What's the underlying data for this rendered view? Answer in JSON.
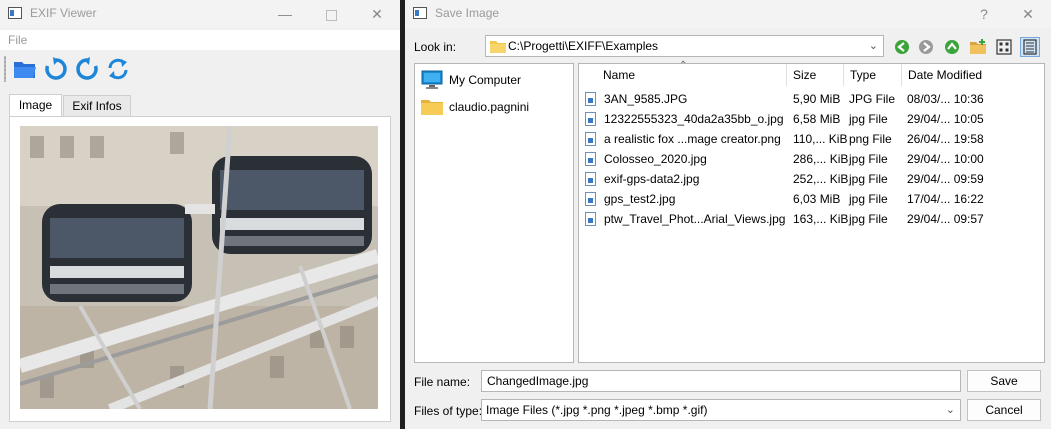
{
  "exif_viewer": {
    "title": "EXIF Viewer",
    "menu": {
      "file": "File"
    },
    "toolbar": {
      "open": "folder-open-icon",
      "rotate_cw": "rotate-clockwise-icon",
      "rotate_ccw": "rotate-counterclockwise-icon",
      "refresh": "refresh-icon"
    },
    "tabs": [
      {
        "label": "Image"
      },
      {
        "label": "Exif Infos"
      }
    ],
    "active_tab": "Image"
  },
  "save_dialog": {
    "title": "Save Image",
    "help_button": "?",
    "close_button": "✕",
    "look_in_label": "Look in:",
    "look_in_path": "C:\\Progetti\\EXIFF\\Examples",
    "sidebar": [
      {
        "label": "My Computer",
        "icon": "computer-icon"
      },
      {
        "label": "claudio.pagnini",
        "icon": "folder-icon"
      }
    ],
    "columns": {
      "name": "Name",
      "size": "Size",
      "type": "Type",
      "date": "Date Modified"
    },
    "files": [
      {
        "name": "3AN_9585.JPG",
        "size": "5,90 MiB",
        "type": "JPG File",
        "date": "08/03/... 10:36"
      },
      {
        "name": "12322555323_40da2a35bb_o.jpg",
        "size": "6,58 MiB",
        "type": "jpg File",
        "date": "29/04/... 10:05"
      },
      {
        "name": "a realistic fox ...mage creator.png",
        "size": "110,... KiB",
        "type": "png File",
        "date": "26/04/... 19:58"
      },
      {
        "name": "Colosseo_2020.jpg",
        "size": "286,... KiB",
        "type": "jpg File",
        "date": "29/04/... 10:00"
      },
      {
        "name": "exif-gps-data2.jpg",
        "size": "252,... KiB",
        "type": "jpg File",
        "date": "29/04/... 09:59"
      },
      {
        "name": "gps_test2.jpg",
        "size": "6,03 MiB",
        "type": "jpg File",
        "date": "17/04/... 16:22"
      },
      {
        "name": "ptw_Travel_Phot...Arial_Views.jpg",
        "size": "163,... KiB",
        "type": "jpg File",
        "date": "29/04/... 09:57"
      }
    ],
    "file_name_label": "File name:",
    "file_name_value": "ChangedImage.jpg",
    "files_of_type_label": "Files of type:",
    "files_of_type_value": "Image Files (*.jpg *.png *.jpeg *.bmp *.gif)",
    "save_button": "Save",
    "cancel_button": "Cancel"
  }
}
